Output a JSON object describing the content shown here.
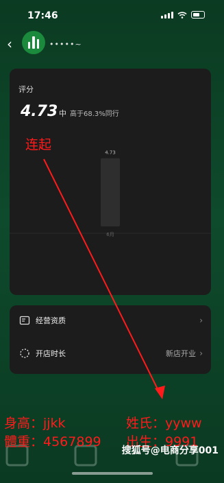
{
  "status_bar": {
    "time": "17:46"
  },
  "header": {
    "store_name": "•••••~"
  },
  "score_card": {
    "title": "评分",
    "score": "4.73",
    "level": "中",
    "compare": "高于68.3%同行"
  },
  "chart_data": {
    "type": "bar",
    "categories": [
      "6月"
    ],
    "values": [
      4.73
    ],
    "data_labels": [
      "4.73"
    ],
    "ylim": [
      0,
      5
    ]
  },
  "info_card": {
    "rows": [
      {
        "label": "经营资质",
        "value": ""
      },
      {
        "label": "开店时长",
        "value": "新店开业"
      }
    ]
  },
  "annotations": {
    "link_text": "连起",
    "height_label": "身高：jjkk",
    "weight_label": "體重：4567899",
    "surname_label": "姓氏：yyww",
    "birth_label": "出生：9991",
    "watermark": "搜狐号@电商分享001",
    "arrow_color": "#ff1b1b"
  }
}
